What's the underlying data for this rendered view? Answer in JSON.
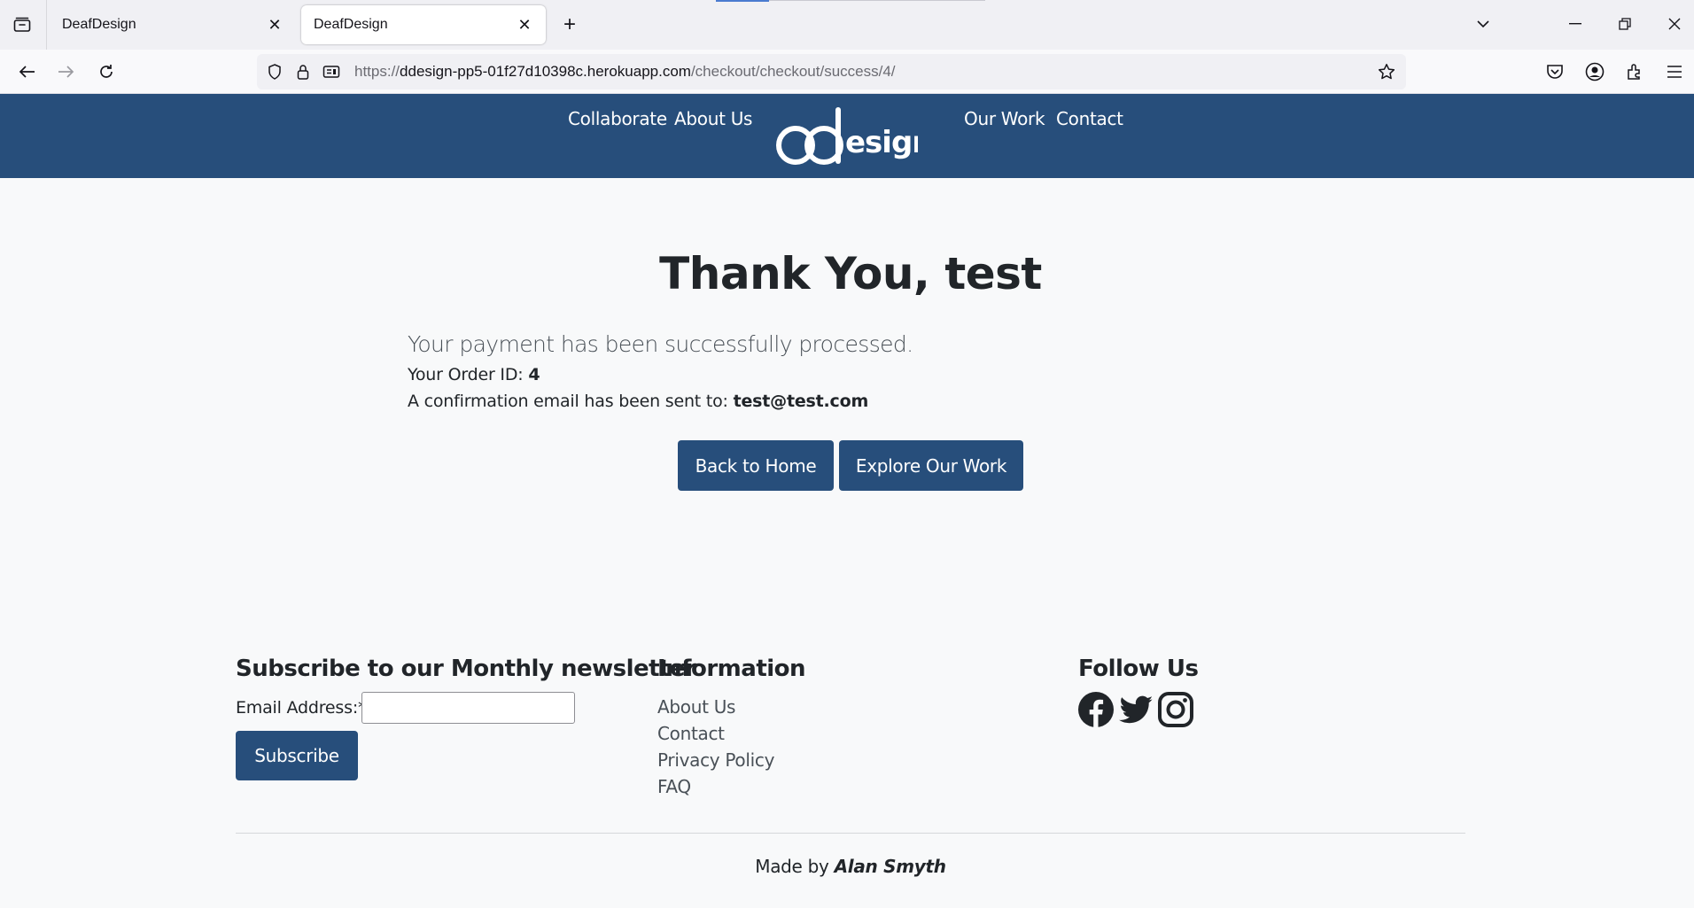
{
  "browser": {
    "tabs": [
      {
        "title": "DeafDesign",
        "active": false
      },
      {
        "title": "DeafDesign",
        "active": true
      }
    ],
    "url": {
      "scheme": "https://",
      "host": "ddesign-pp5-01f27d10398c.herokuapp.com",
      "path": "/checkout/checkout/success/4/"
    }
  },
  "site": {
    "nav_left": [
      "Collaborate",
      "About Us"
    ],
    "nav_right": [
      "Our Work",
      "Contact"
    ],
    "logo_text": "ddesign",
    "brand_color": "#274e7b"
  },
  "main": {
    "title": "Thank You, test",
    "lead": "Your payment has been successfully processed.",
    "order_label": "Your Order ID: ",
    "order_id": "4",
    "email_label": "A confirmation email has been sent to: ",
    "email": "test@test.com",
    "back_button": "Back to Home",
    "explore_button": "Explore Our Work"
  },
  "footer": {
    "newsletter_heading": "Subscribe to our Monthly newsletter",
    "email_field_label": "Email Address:*",
    "subscribe_button": "Subscribe",
    "info_heading": "Information",
    "info_links": [
      "About Us",
      "Contact",
      "Privacy Policy",
      "FAQ"
    ],
    "follow_heading": "Follow Us",
    "social_icons": [
      "facebook-icon",
      "twitter-icon",
      "instagram-icon"
    ],
    "made_by_prefix": "Made by ",
    "made_by_name": "Alan Smyth"
  }
}
